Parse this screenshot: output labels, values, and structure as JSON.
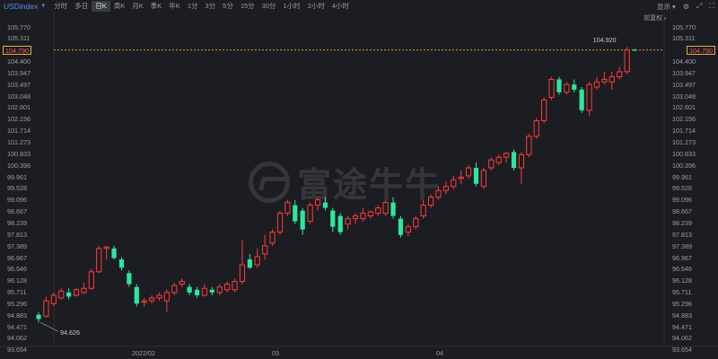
{
  "toolbar": {
    "symbol": "USDindex",
    "timeframes": [
      "分时",
      "多日",
      "日K",
      "周K",
      "月K",
      "季K",
      "年K",
      "1分",
      "3分",
      "5分",
      "15分",
      "30分",
      "1小时",
      "2小时",
      "4小时"
    ],
    "active_timeframe": "日K",
    "display_label": "显示",
    "adjust_label": "前复权"
  },
  "watermark": "富途牛牛",
  "colors": {
    "up": "#ff3b3b",
    "down": "#2ee6a0",
    "background": "#1c1d22",
    "current_price_line": "#e6b13a"
  },
  "current_price": "104.790",
  "annotations": {
    "high": "104.920",
    "low": "94.626"
  },
  "chart_data": {
    "type": "candlestick",
    "y_axis_labels": [
      "105.770",
      "105.311",
      "104.790",
      "104.400",
      "103.947",
      "103.497",
      "103.048",
      "102.601",
      "102.156",
      "101.714",
      "101.273",
      "100.833",
      "100.396",
      "99.961",
      "99.528",
      "99.096",
      "98.667",
      "98.239",
      "97.813",
      "97.389",
      "96.967",
      "96.546",
      "96.128",
      "95.711",
      "95.296",
      "94.883",
      "94.471",
      "94.062",
      "93.654"
    ],
    "x_axis_labels": [
      "2022/02",
      "03",
      "04"
    ],
    "ylim": [
      93.654,
      105.77
    ],
    "high_value": 104.92,
    "low_value": 94.626,
    "candles": [
      {
        "o": 94.9,
        "h": 95.0,
        "l": 94.626,
        "c": 94.75
      },
      {
        "o": 94.85,
        "h": 95.55,
        "l": 94.8,
        "c": 95.4
      },
      {
        "o": 95.3,
        "h": 95.7,
        "l": 95.2,
        "c": 95.6
      },
      {
        "o": 95.5,
        "h": 95.85,
        "l": 95.45,
        "c": 95.75
      },
      {
        "o": 95.7,
        "h": 95.85,
        "l": 95.45,
        "c": 95.55
      },
      {
        "o": 95.6,
        "h": 95.85,
        "l": 95.55,
        "c": 95.8
      },
      {
        "o": 95.7,
        "h": 96.05,
        "l": 95.65,
        "c": 95.85
      },
      {
        "o": 95.85,
        "h": 96.55,
        "l": 95.8,
        "c": 96.45
      },
      {
        "o": 96.45,
        "h": 97.4,
        "l": 96.4,
        "c": 97.3
      },
      {
        "o": 97.3,
        "h": 97.4,
        "l": 96.9,
        "c": 97.35
      },
      {
        "o": 97.3,
        "h": 97.4,
        "l": 96.9,
        "c": 96.95
      },
      {
        "o": 96.9,
        "h": 96.98,
        "l": 96.5,
        "c": 96.6
      },
      {
        "o": 96.4,
        "h": 96.5,
        "l": 95.9,
        "c": 96.0
      },
      {
        "o": 95.9,
        "h": 96.0,
        "l": 95.2,
        "c": 95.3
      },
      {
        "o": 95.35,
        "h": 95.5,
        "l": 95.2,
        "c": 95.4
      },
      {
        "o": 95.4,
        "h": 95.6,
        "l": 95.3,
        "c": 95.5
      },
      {
        "o": 95.5,
        "h": 95.7,
        "l": 95.4,
        "c": 95.6
      },
      {
        "o": 95.4,
        "h": 95.8,
        "l": 95.0,
        "c": 95.7
      },
      {
        "o": 95.7,
        "h": 96.05,
        "l": 95.6,
        "c": 95.95
      },
      {
        "o": 96.0,
        "h": 96.2,
        "l": 95.9,
        "c": 96.1
      },
      {
        "o": 95.9,
        "h": 96.0,
        "l": 95.6,
        "c": 95.7
      },
      {
        "o": 95.8,
        "h": 95.9,
        "l": 95.5,
        "c": 95.6
      },
      {
        "o": 95.6,
        "h": 96.0,
        "l": 95.55,
        "c": 95.85
      },
      {
        "o": 95.8,
        "h": 95.9,
        "l": 95.6,
        "c": 95.7
      },
      {
        "o": 95.7,
        "h": 96.0,
        "l": 95.6,
        "c": 95.9
      },
      {
        "o": 95.8,
        "h": 96.1,
        "l": 95.7,
        "c": 96.0
      },
      {
        "o": 95.8,
        "h": 96.2,
        "l": 95.7,
        "c": 96.1
      },
      {
        "o": 96.1,
        "h": 97.6,
        "l": 96.0,
        "c": 96.7
      },
      {
        "o": 96.9,
        "h": 97.1,
        "l": 96.55,
        "c": 96.6
      },
      {
        "o": 96.7,
        "h": 97.3,
        "l": 96.6,
        "c": 97.0
      },
      {
        "o": 97.1,
        "h": 97.8,
        "l": 96.9,
        "c": 97.4
      },
      {
        "o": 97.5,
        "h": 98.0,
        "l": 97.4,
        "c": 97.9
      },
      {
        "o": 97.9,
        "h": 98.7,
        "l": 97.8,
        "c": 98.6
      },
      {
        "o": 98.6,
        "h": 99.1,
        "l": 98.5,
        "c": 99.0
      },
      {
        "o": 98.9,
        "h": 99.1,
        "l": 98.2,
        "c": 98.3
      },
      {
        "o": 98.7,
        "h": 98.8,
        "l": 97.8,
        "c": 98.0
      },
      {
        "o": 98.3,
        "h": 99.0,
        "l": 98.2,
        "c": 98.9
      },
      {
        "o": 98.9,
        "h": 99.2,
        "l": 98.7,
        "c": 99.1
      },
      {
        "o": 99.0,
        "h": 99.2,
        "l": 98.7,
        "c": 98.8
      },
      {
        "o": 98.7,
        "h": 98.8,
        "l": 97.9,
        "c": 98.1
      },
      {
        "o": 98.5,
        "h": 98.6,
        "l": 97.8,
        "c": 97.9
      },
      {
        "o": 98.2,
        "h": 98.5,
        "l": 98.0,
        "c": 98.4
      },
      {
        "o": 98.4,
        "h": 98.6,
        "l": 98.2,
        "c": 98.5
      },
      {
        "o": 98.4,
        "h": 98.8,
        "l": 98.3,
        "c": 98.6
      },
      {
        "o": 98.5,
        "h": 98.7,
        "l": 98.4,
        "c": 98.65
      },
      {
        "o": 98.6,
        "h": 98.9,
        "l": 98.5,
        "c": 98.8
      },
      {
        "o": 98.6,
        "h": 99.1,
        "l": 98.5,
        "c": 99.0
      },
      {
        "o": 99.0,
        "h": 99.2,
        "l": 98.4,
        "c": 98.5
      },
      {
        "o": 98.4,
        "h": 98.5,
        "l": 97.7,
        "c": 97.8
      },
      {
        "o": 97.9,
        "h": 98.2,
        "l": 97.75,
        "c": 98.1
      },
      {
        "o": 98.1,
        "h": 98.5,
        "l": 98.0,
        "c": 98.4
      },
      {
        "o": 98.5,
        "h": 99.1,
        "l": 98.4,
        "c": 98.9
      },
      {
        "o": 98.9,
        "h": 99.3,
        "l": 98.8,
        "c": 99.2
      },
      {
        "o": 99.2,
        "h": 99.6,
        "l": 99.1,
        "c": 99.45
      },
      {
        "o": 99.45,
        "h": 99.8,
        "l": 99.3,
        "c": 99.6
      },
      {
        "o": 99.6,
        "h": 100.0,
        "l": 99.5,
        "c": 99.85
      },
      {
        "o": 99.9,
        "h": 100.2,
        "l": 99.7,
        "c": 99.95
      },
      {
        "o": 100.0,
        "h": 100.4,
        "l": 99.9,
        "c": 100.3
      },
      {
        "o": 100.3,
        "h": 100.5,
        "l": 99.6,
        "c": 99.7
      },
      {
        "o": 99.6,
        "h": 100.3,
        "l": 99.5,
        "c": 100.2
      },
      {
        "o": 100.3,
        "h": 100.7,
        "l": 100.2,
        "c": 100.6
      },
      {
        "o": 100.5,
        "h": 100.8,
        "l": 100.4,
        "c": 100.7
      },
      {
        "o": 100.7,
        "h": 100.9,
        "l": 100.5,
        "c": 100.85
      },
      {
        "o": 100.9,
        "h": 101.0,
        "l": 100.2,
        "c": 100.3
      },
      {
        "o": 100.3,
        "h": 100.9,
        "l": 99.7,
        "c": 100.8
      },
      {
        "o": 100.8,
        "h": 101.6,
        "l": 100.7,
        "c": 101.5
      },
      {
        "o": 101.5,
        "h": 102.2,
        "l": 101.4,
        "c": 102.1
      },
      {
        "o": 102.1,
        "h": 103.0,
        "l": 102.0,
        "c": 102.9
      },
      {
        "o": 103.0,
        "h": 103.8,
        "l": 102.9,
        "c": 103.7
      },
      {
        "o": 103.7,
        "h": 103.8,
        "l": 103.1,
        "c": 103.2
      },
      {
        "o": 103.2,
        "h": 103.6,
        "l": 103.1,
        "c": 103.5
      },
      {
        "o": 103.5,
        "h": 103.7,
        "l": 103.2,
        "c": 103.3
      },
      {
        "o": 103.3,
        "h": 103.4,
        "l": 102.4,
        "c": 102.5
      },
      {
        "o": 102.5,
        "h": 103.6,
        "l": 102.3,
        "c": 103.5
      },
      {
        "o": 103.4,
        "h": 103.8,
        "l": 103.3,
        "c": 103.6
      },
      {
        "o": 103.6,
        "h": 104.0,
        "l": 103.5,
        "c": 103.7
      },
      {
        "o": 103.6,
        "h": 104.0,
        "l": 103.3,
        "c": 103.8
      },
      {
        "o": 103.8,
        "h": 104.2,
        "l": 103.7,
        "c": 104.0
      },
      {
        "o": 104.0,
        "h": 104.92,
        "l": 103.9,
        "c": 104.79
      },
      {
        "o": 104.8,
        "h": 104.85,
        "l": 104.75,
        "c": 104.79
      }
    ]
  }
}
